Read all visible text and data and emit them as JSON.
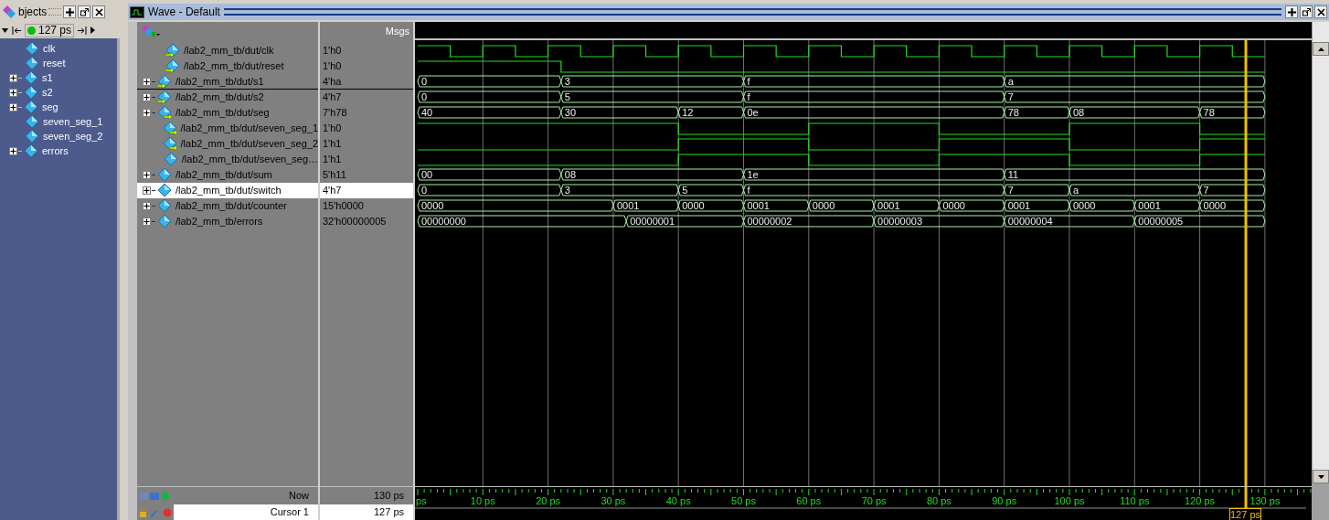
{
  "objects_panel": {
    "title": "bjects",
    "toolbar_time": "127 ps",
    "items": [
      {
        "name": "clk",
        "expandable": false
      },
      {
        "name": "reset",
        "expandable": false
      },
      {
        "name": "s1",
        "expandable": true
      },
      {
        "name": "s2",
        "expandable": true
      },
      {
        "name": "seg",
        "expandable": true
      },
      {
        "name": "seven_seg_1",
        "expandable": false
      },
      {
        "name": "seven_seg_2",
        "expandable": false
      },
      {
        "name": "errors",
        "expandable": true
      }
    ]
  },
  "wave_window": {
    "title": "Wave - Default",
    "msgs_header": "Msgs",
    "signals": [
      {
        "name": "/lab2_mm_tb/dut/clk",
        "value": "1'h0",
        "kind": "bit",
        "in_port": true,
        "out_port": false,
        "expandable": false,
        "selected": false
      },
      {
        "name": "/lab2_mm_tb/dut/reset",
        "value": "1'h0",
        "kind": "bit",
        "in_port": true,
        "out_port": false,
        "expandable": false,
        "selected": false
      },
      {
        "name": "/lab2_mm_tb/dut/s1",
        "value": "4'ha",
        "kind": "bus",
        "in_port": true,
        "out_port": false,
        "expandable": true,
        "selected": false,
        "segments": [
          "0",
          "3",
          "f",
          "a"
        ]
      },
      {
        "name": "/lab2_mm_tb/dut/s2",
        "value": "4'h7",
        "kind": "bus",
        "in_port": true,
        "out_port": false,
        "expandable": true,
        "selected": false,
        "segments": [
          "0",
          "5",
          "f",
          "7"
        ]
      },
      {
        "name": "/lab2_mm_tb/dut/seg",
        "value": "7'h78",
        "kind": "bus",
        "in_port": false,
        "out_port": true,
        "expandable": true,
        "selected": false,
        "segments": [
          "40",
          "30",
          "12",
          "0e",
          "78",
          "08",
          "78"
        ]
      },
      {
        "name": "/lab2_mm_tb/dut/seven_seg_1",
        "value": "1'h0",
        "kind": "bit",
        "in_port": false,
        "out_port": true,
        "expandable": false,
        "selected": false
      },
      {
        "name": "/lab2_mm_tb/dut/seven_seg_2",
        "value": "1'h1",
        "kind": "bit",
        "in_port": false,
        "out_port": true,
        "expandable": false,
        "selected": false
      },
      {
        "name": "/lab2_mm_tb/dut/seven_seg…",
        "value": "1'h1",
        "kind": "bit",
        "in_port": false,
        "out_port": false,
        "expandable": false,
        "selected": false
      },
      {
        "name": "/lab2_mm_tb/dut/sum",
        "value": "5'h11",
        "kind": "bus",
        "in_port": false,
        "out_port": false,
        "expandable": true,
        "selected": false,
        "segments": [
          "00",
          "08",
          "1e",
          "11"
        ]
      },
      {
        "name": "/lab2_mm_tb/dut/switch",
        "value": "4'h7",
        "kind": "bus",
        "in_port": false,
        "out_port": false,
        "expandable": true,
        "selected": true,
        "segments": [
          "0",
          "3",
          "5",
          "f",
          "7",
          "a",
          "7"
        ]
      },
      {
        "name": "/lab2_mm_tb/dut/counter",
        "value": "15'h0000",
        "kind": "bus",
        "in_port": false,
        "out_port": false,
        "expandable": true,
        "selected": false,
        "segments": [
          "0000",
          "0001",
          "0000",
          "0001",
          "0000",
          "0001",
          "0000",
          "0001",
          "0000",
          "0001",
          "0000"
        ]
      },
      {
        "name": "/lab2_mm_tb/errors",
        "value": "32'h00000005",
        "kind": "bus",
        "in_port": false,
        "out_port": false,
        "expandable": true,
        "selected": false,
        "segments": [
          "00000000",
          "00000001",
          "00000002",
          "00000003",
          "00000004",
          "00000005"
        ]
      }
    ],
    "now": {
      "label": "Now",
      "value": "130 ps"
    },
    "cursor": {
      "label": "Cursor 1",
      "value": "127 ps",
      "marker": "127 ps"
    },
    "time_labels": [
      "ps",
      "10 ps",
      "20 ps",
      "30 ps",
      "40 ps",
      "50 ps",
      "60 ps",
      "70 ps",
      "80 ps",
      "90 ps",
      "100 ps",
      "110 ps",
      "120 ps",
      "130 ps"
    ]
  }
}
